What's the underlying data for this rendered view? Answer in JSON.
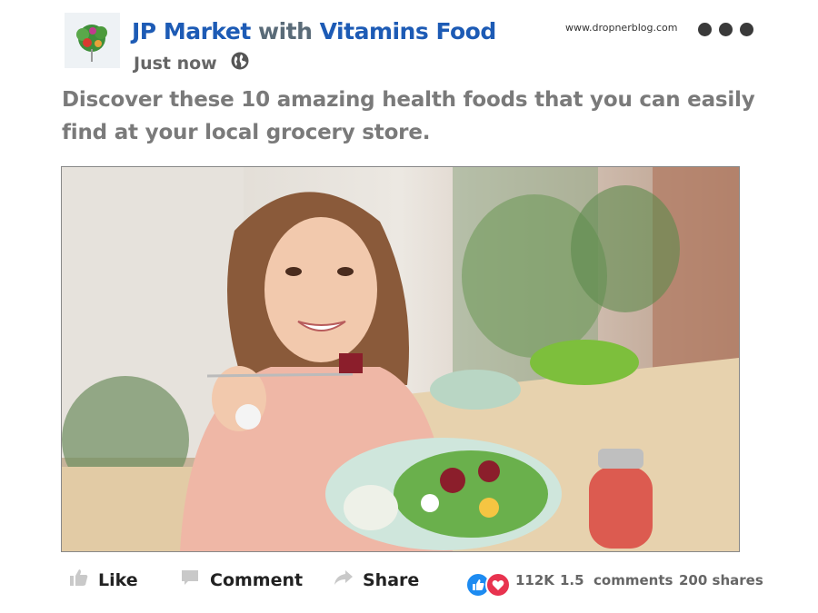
{
  "header": {
    "brand_name": "JP Market",
    "with_text": "with",
    "partner_name": "Vitamins Food",
    "timestamp": "Just now",
    "privacy_icon": "globe-icon",
    "website": "www.dropnerblog.com",
    "menu_icon": "more-options-icon"
  },
  "post": {
    "text": "Discover these 10 amazing health foods that you can easily find at your local grocery store."
  },
  "actions": {
    "like_label": "Like",
    "comment_label": "Comment",
    "share_label": "Share"
  },
  "stats": {
    "reactions_count": "112K",
    "comments_count": "1.5",
    "comments_label": "comments",
    "shares": "200 shares"
  },
  "colors": {
    "brand_blue": "#1d5bb5",
    "like_blue": "#1d8bf1",
    "love_red": "#e8334f"
  }
}
